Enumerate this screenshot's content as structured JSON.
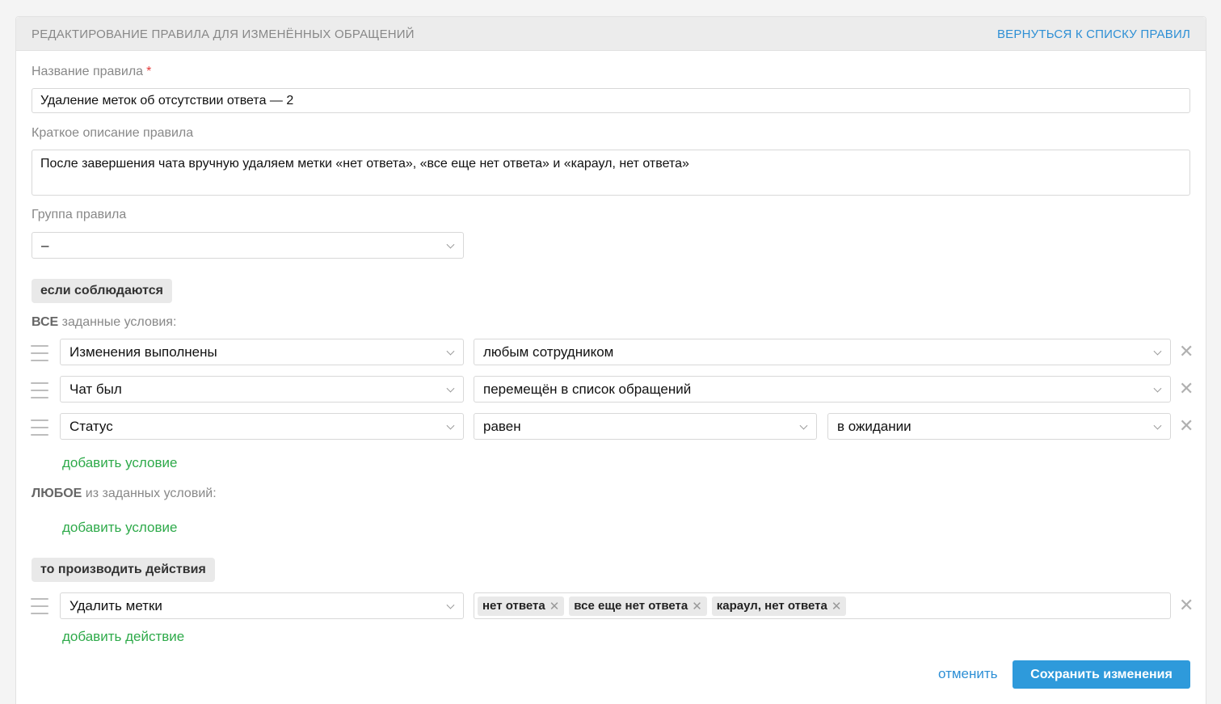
{
  "header": {
    "title": "РЕДАКТИРОВАНИЕ ПРАВИЛА ДЛЯ ИЗМЕНЁННЫХ ОБРАЩЕНИЙ",
    "back_link": "ВЕРНУТЬСЯ К СПИСКУ ПРАВИЛ"
  },
  "form": {
    "name_label": "Название правила",
    "required_mark": "*",
    "name_value": "Удаление меток об отсутствии ответа — 2",
    "description_label": "Краткое описание правила",
    "description_value": "После завершения чата вручную удаляем метки «нет ответа»,  «все еще нет ответа» и «караул, нет ответа»",
    "group_label": "Группа правила",
    "group_value": "–"
  },
  "conditions": {
    "section_label": "если соблюдаются",
    "all_heading_bold": "ВСЕ",
    "all_heading_rest": " заданные условия:",
    "rows": [
      {
        "field": "Изменения выполнены",
        "operator": "любым сотрудником"
      },
      {
        "field": "Чат был",
        "operator": "перемещён в список обращений"
      },
      {
        "field": "Статус",
        "operator": "равен",
        "value": "в ожидании"
      }
    ],
    "add_all_label": "добавить условие",
    "any_heading_bold": "ЛЮБОЕ",
    "any_heading_rest": " из заданных условий:",
    "add_any_label": "добавить условие"
  },
  "actions": {
    "section_label": "то производить действия",
    "rows": [
      {
        "action": "Удалить метки",
        "tags": [
          "нет ответа",
          "все еще нет ответа",
          "караул, нет ответа"
        ]
      }
    ],
    "add_label": "добавить действие"
  },
  "footer": {
    "cancel_label": "отменить",
    "save_label": "Сохранить изменения"
  },
  "icons": {
    "remove": "close-icon",
    "drag": "drag-handle-icon",
    "dropdown": "chevron-down-icon",
    "remove_glyph": "✕",
    "tag_remove_glyph": "✕"
  },
  "colors": {
    "accent_blue": "#2e9adb",
    "link_green": "#2eaa4a",
    "required_red": "#e53b3b"
  }
}
